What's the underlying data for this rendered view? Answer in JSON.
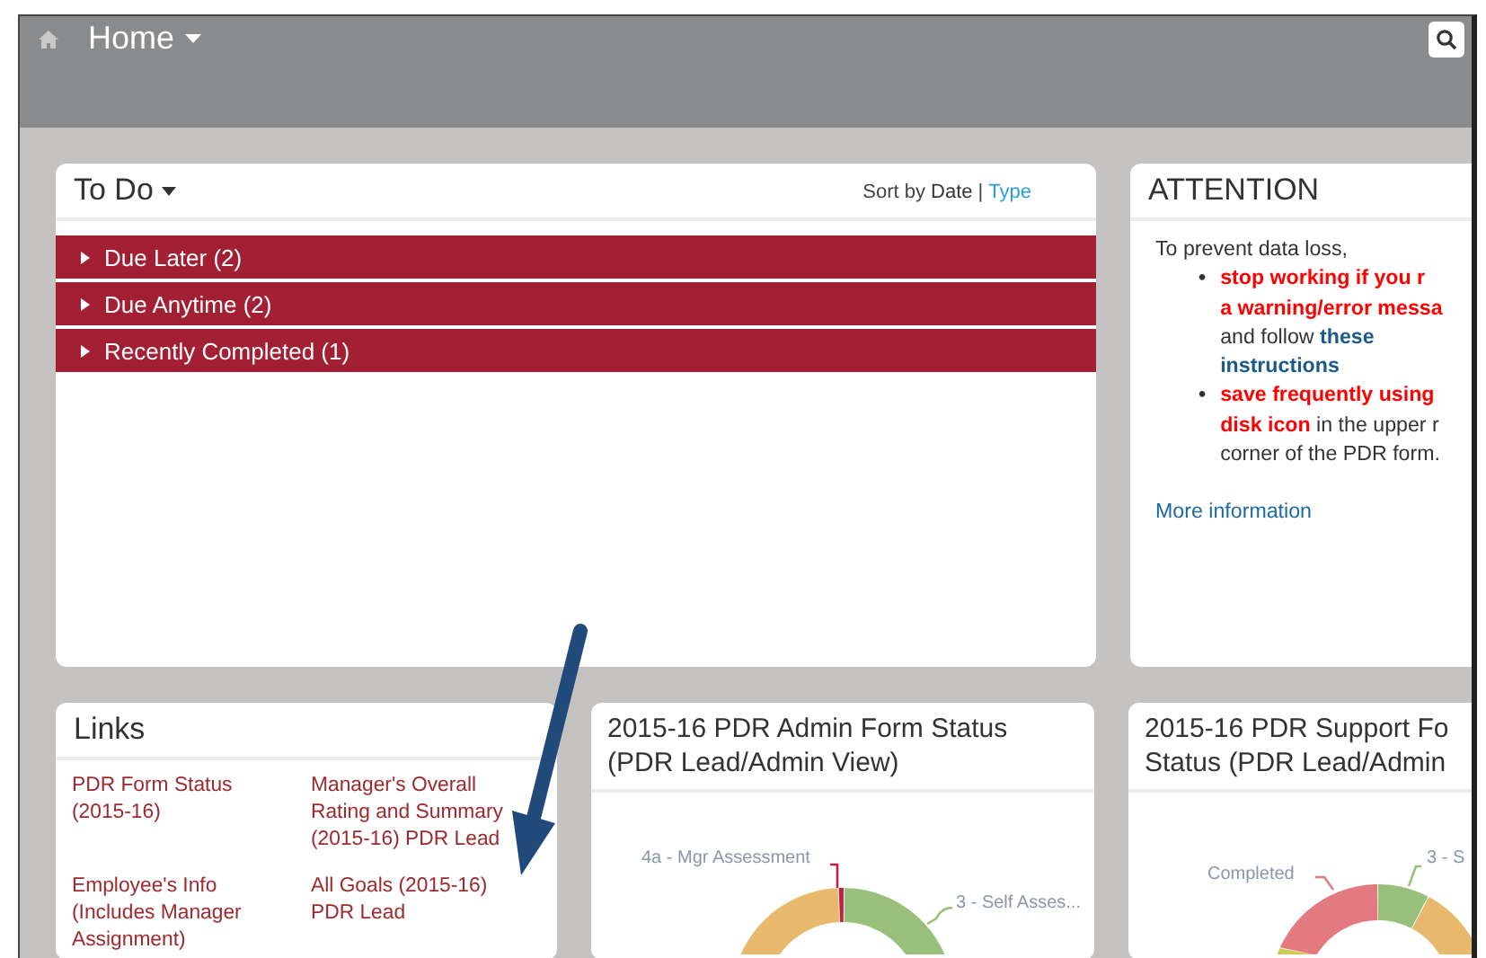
{
  "top_bar": {
    "title": "Home"
  },
  "todo": {
    "title": "To Do",
    "sort": {
      "label": "Sort by",
      "separator": "|",
      "options": [
        {
          "label": "Date",
          "selected": true
        },
        {
          "label": "Type",
          "selected": false
        }
      ]
    },
    "groups": [
      {
        "label": "Due Later (2)",
        "expanded": false
      },
      {
        "label": "Due Anytime (2)",
        "expanded": false
      },
      {
        "label": "Recently Completed (1)",
        "expanded": false
      }
    ]
  },
  "attention": {
    "title": "ATTENTION",
    "intro": "To prevent data loss,",
    "marker": "•",
    "bullets": [
      [
        [
          {
            "kind": "alert",
            "text": "stop working if you r"
          }
        ],
        [
          {
            "kind": "alert",
            "text": "a warning/error messa"
          }
        ],
        [
          {
            "kind": "plain",
            "text": "and follow "
          },
          {
            "kind": "link",
            "text": "these"
          }
        ],
        [
          {
            "kind": "link",
            "text": "instructions"
          }
        ]
      ],
      [
        [
          {
            "kind": "alert",
            "text": "save frequently using"
          }
        ],
        [
          {
            "kind": "alert",
            "text": "disk icon"
          },
          {
            "kind": "plain",
            "text": " in the upper r"
          }
        ],
        [
          {
            "kind": "plain",
            "text": "corner of the PDR form."
          }
        ]
      ]
    ],
    "more_link": "More information"
  },
  "links": {
    "title": "Links",
    "items": [
      "PDR Form Status (2015-16)",
      "Manager's Overall Rating and Summary (2015-16) PDR Lead",
      "Employee's Info (Includes Manager Assignment)",
      "All Goals (2015-16) PDR Lead"
    ]
  },
  "charts": [
    {
      "title_lines": [
        "2015-16 PDR Admin Form Status",
        "(PDR Lead/Admin View)"
      ],
      "labels": [
        "4a - Mgr Assessment",
        "3 - Self Asses..."
      ]
    },
    {
      "title_lines": [
        "2015-16 PDR Support Fo",
        "Status (PDR Lead/Admin"
      ],
      "labels": [
        "Completed",
        "3 - S"
      ]
    }
  ]
}
